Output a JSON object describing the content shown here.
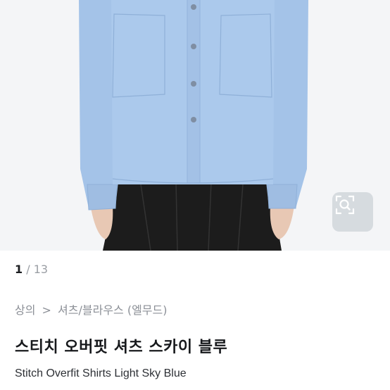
{
  "gallery": {
    "current": "1",
    "separator": " / ",
    "total": "13",
    "image_alt": "Stitch Overfit Shirts Light Sky Blue",
    "zoom_icon": "zoom-search-icon"
  },
  "breadcrumb": {
    "category": "상의",
    "separator": ">",
    "subcategory": "셔츠/블라우스 (엘무드)"
  },
  "product": {
    "title_ko": "스티치 오버핏 셔츠 스카이 블루",
    "title_en": "Stitch Overfit Shirts Light Sky Blue"
  },
  "colors": {
    "shirt": "#a9c7ea",
    "skirt": "#1f1f1f",
    "background": "#f4f5f7"
  }
}
